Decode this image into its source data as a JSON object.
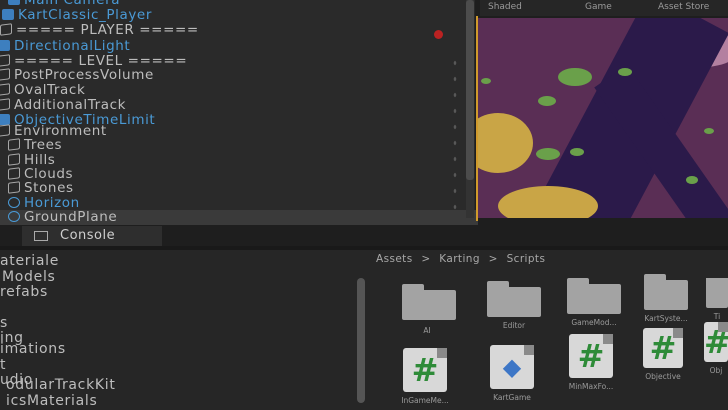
{
  "hierarchy": {
    "items": [
      {
        "label": "Main Camera",
        "style": "blue",
        "icon": "prefab"
      },
      {
        "label": "KartClassic_Player",
        "style": "blue",
        "icon": "prefab"
      },
      {
        "label": "===== PLAYER =====",
        "style": "normal",
        "icon": "cube"
      },
      {
        "label": "DirectionalLight",
        "style": "blue",
        "icon": "prefab"
      },
      {
        "label": "===== LEVEL =====",
        "style": "normal",
        "icon": "cube"
      },
      {
        "label": "PostProcessVolume",
        "style": "normal",
        "icon": "cube"
      },
      {
        "label": "OvalTrack",
        "style": "normal",
        "icon": "cube"
      },
      {
        "label": "AdditionalTrack",
        "style": "normal",
        "icon": "cube"
      },
      {
        "label": "ObjectiveTimeLimit",
        "style": "blue",
        "icon": "prefab"
      },
      {
        "label": "Environment",
        "style": "normal",
        "icon": "cube"
      },
      {
        "label": "Trees",
        "style": "normal",
        "icon": "cube"
      },
      {
        "label": "Hills",
        "style": "normal",
        "icon": "cube"
      },
      {
        "label": "Clouds",
        "style": "normal",
        "icon": "cube"
      },
      {
        "label": "Stones",
        "style": "normal",
        "icon": "cube"
      },
      {
        "label": "Horizon",
        "style": "blue",
        "icon": "globe"
      },
      {
        "label": "GroundPlane",
        "style": "selected",
        "icon": "globe"
      }
    ]
  },
  "view_tabs": {
    "shaded": "Shaded",
    "game": "Game",
    "asset_store": "Asset Store"
  },
  "console_tab": {
    "label": "Console"
  },
  "project": {
    "tree": [
      {
        "label": "ateriale",
        "style": "normal"
      },
      {
        "label": "Models",
        "style": "normal"
      },
      {
        "label": "refabs",
        "style": "normal"
      },
      {
        "label": "",
        "style": "normal"
      },
      {
        "label": "s",
        "style": "normal"
      },
      {
        "label": "ing",
        "style": "normal"
      },
      {
        "label": "imations",
        "style": "normal"
      },
      {
        "label": "t",
        "style": "normal"
      },
      {
        "label": "udio",
        "style": "normal"
      },
      {
        "label": "odularTrackKit",
        "style": "normal"
      },
      {
        "label": "icsMaterials",
        "style": "normal"
      }
    ],
    "breadcrumb": [
      "Assets",
      ">",
      "Karting",
      ">",
      "Scripts"
    ],
    "assets_row1": [
      {
        "label": "",
        "kind": "folder"
      },
      {
        "label": "AI",
        "kind": "folder"
      },
      {
        "label": "Editor",
        "kind": "folder"
      },
      {
        "label": "GameMod...",
        "kind": "folder"
      },
      {
        "label": "KartSyste...",
        "kind": "folder"
      },
      {
        "label": "Ti",
        "kind": "folder"
      }
    ],
    "assets_row2": [
      {
        "label": "InGameMe...",
        "kind": "script",
        "glyph": "#"
      },
      {
        "label": "KartGame",
        "kind": "unity",
        "glyph": "◆"
      },
      {
        "label": "MinMaxFo...",
        "kind": "script",
        "glyph": "#"
      },
      {
        "label": "Objective",
        "kind": "script",
        "glyph": "#"
      },
      {
        "label": "Obj",
        "kind": "script",
        "glyph": "#"
      }
    ]
  }
}
